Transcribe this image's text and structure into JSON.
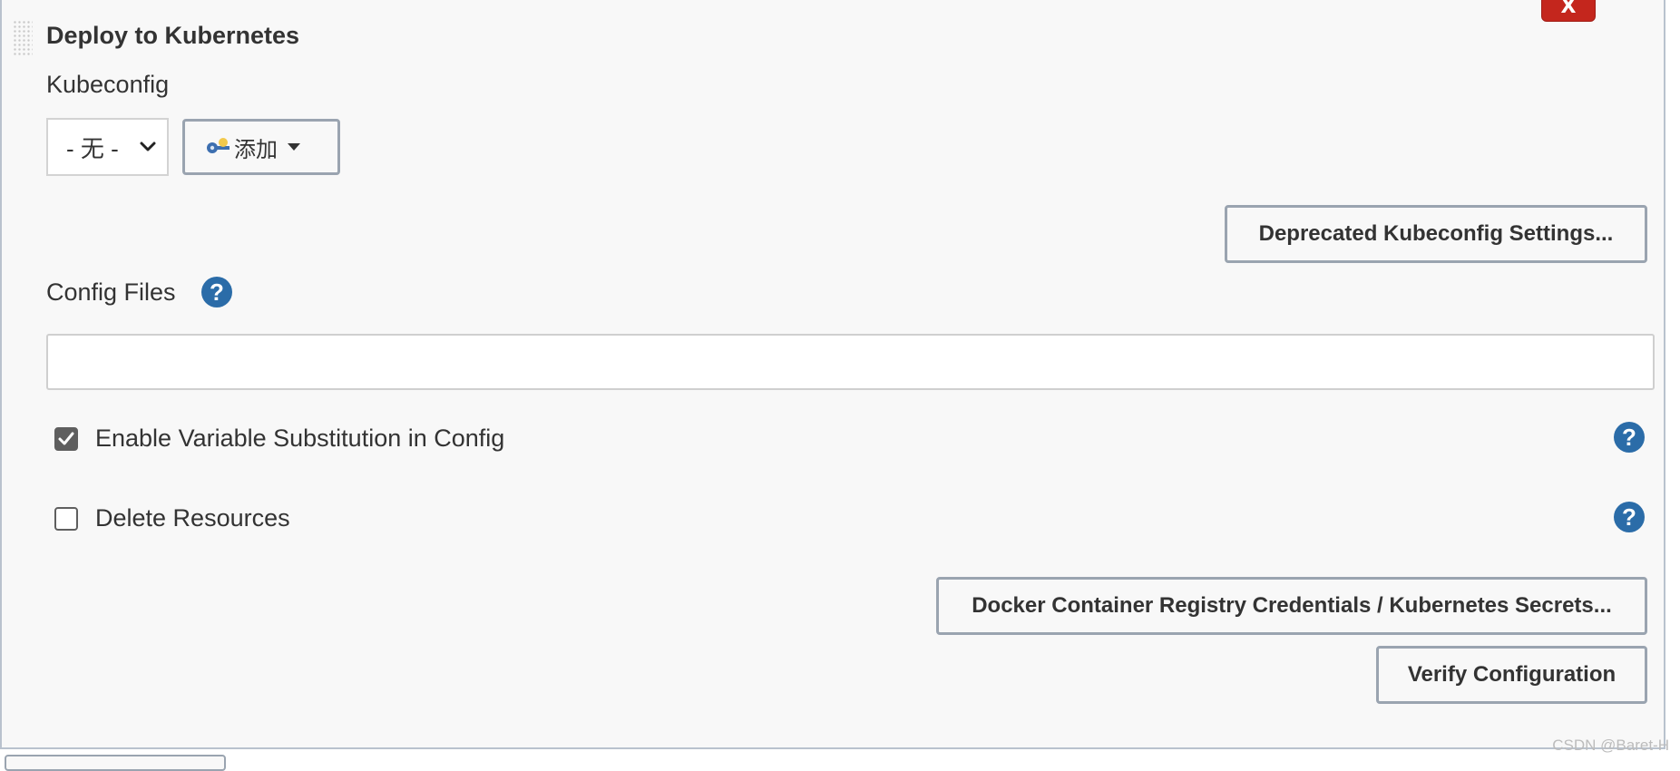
{
  "section": {
    "title": "Deploy to Kubernetes",
    "close_label": "X"
  },
  "kubeconfig": {
    "label": "Kubeconfig",
    "selected_value": "- 无 -",
    "add_button_label": "添加",
    "add_button_icon": "key-icon"
  },
  "deprecated_settings_label": "Deprecated Kubeconfig Settings...",
  "config_files": {
    "label": "Config Files",
    "value": "",
    "help_label": "?"
  },
  "options": {
    "enable_variable_substitution": {
      "label": "Enable Variable Substitution in Config",
      "checked": true
    },
    "delete_resources": {
      "label": "Delete Resources",
      "checked": false
    }
  },
  "buttons": {
    "docker_credentials_label": "Docker Container Registry Credentials / Kubernetes Secrets...",
    "verify_label": "Verify Configuration"
  },
  "watermark": "CSDN @Baret-H",
  "colors": {
    "help_blue": "#2b6ca8",
    "close_red": "#c4261d",
    "button_border": "#9aa4b0",
    "panel_bg": "#f8f8f8"
  }
}
